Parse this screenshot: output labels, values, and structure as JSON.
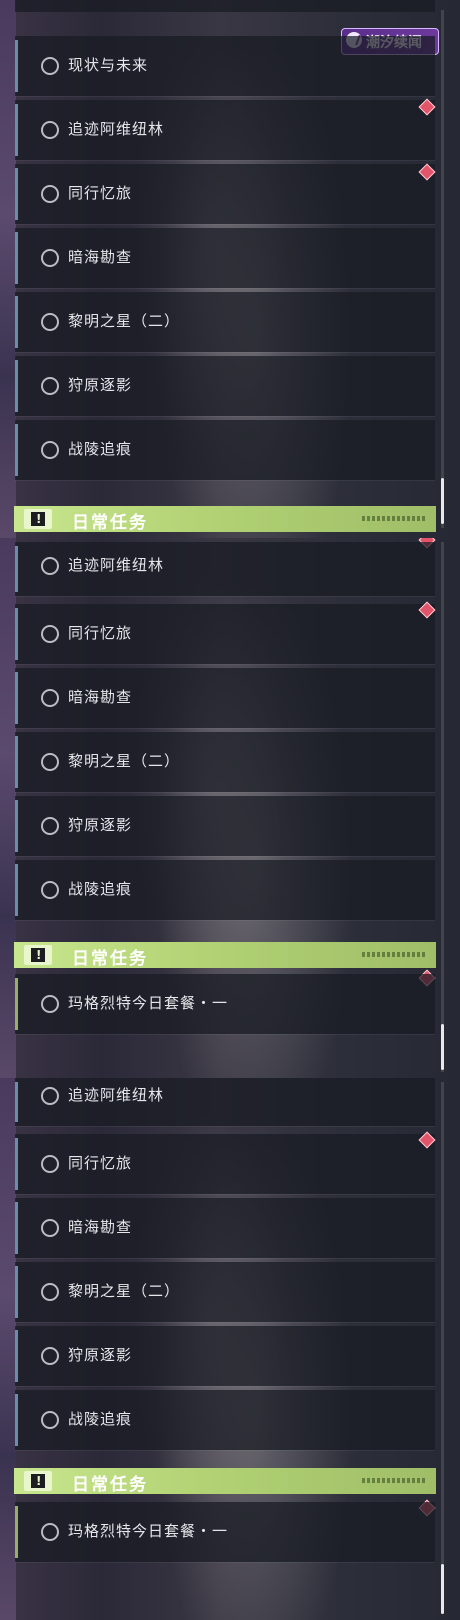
{
  "badge": {
    "text": "潮汐续闻"
  },
  "panel1": {
    "partial_top": "",
    "quests": [
      "现状与未来",
      "追迹阿维纽林",
      "同行忆旅",
      "暗海勘查",
      "黎明之星（二）",
      "狩原逐影",
      "战陵追痕"
    ],
    "daily_header": "日常任务"
  },
  "panel2": {
    "quests": [
      "追迹阿维纽林",
      "同行忆旅",
      "暗海勘查",
      "黎明之星（二）",
      "狩原逐影",
      "战陵追痕"
    ],
    "daily_header": "日常任务",
    "daily_quests": [
      "玛格烈特今日套餐・一"
    ]
  },
  "panel3": {
    "quests": [
      "追迹阿维纽林",
      "同行忆旅",
      "暗海勘查",
      "黎明之星（二）",
      "狩原逐影",
      "战陵追痕"
    ],
    "daily_header": "日常任务",
    "daily_quests": [
      "玛格烈特今日套餐・一"
    ]
  },
  "icons": {
    "quest_status": "circle-icon",
    "tracked": "red-diamond-icon",
    "daily": "exclamation-icon"
  }
}
